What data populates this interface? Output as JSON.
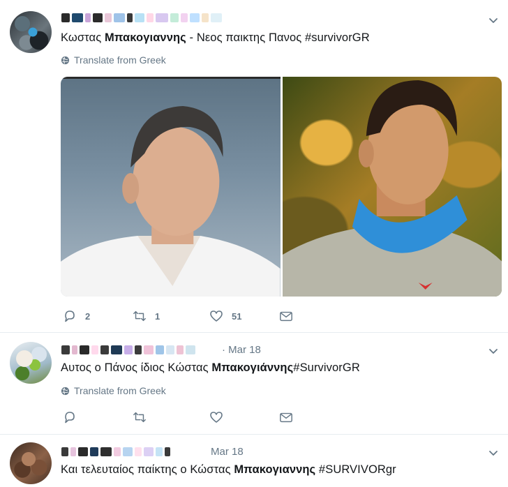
{
  "colors": {
    "text": "#14171a",
    "secondary": "#657786",
    "divider": "#e6ecf0",
    "accent": "#1b95e0"
  },
  "tweets": [
    {
      "date": "",
      "text_pre": "Κωστας ",
      "text_bold": "Μπακογιαννης",
      "text_post": " - Νεος παικτης Πανος  #survivorGR",
      "translate_label": "Translate from Greek",
      "has_media": true,
      "actions": {
        "reply_icon": "reply-icon",
        "reply_count": "2",
        "retweet_icon": "retweet-icon",
        "retweet_count": "1",
        "like_icon": "heart-icon",
        "like_count": "51",
        "dm_icon": "envelope-icon"
      }
    },
    {
      "date": "· Mar 18",
      "text_pre": "Αυτος ο Πάνος ίδιος Κώστας ",
      "text_bold": "Μπακογιάννης",
      "text_post": "#SurvivorGR",
      "translate_label": "Translate from Greek",
      "has_media": false,
      "actions": {
        "reply_icon": "reply-icon",
        "reply_count": "",
        "retweet_icon": "retweet-icon",
        "retweet_count": "",
        "like_icon": "heart-icon",
        "like_count": "",
        "dm_icon": "envelope-icon"
      }
    },
    {
      "date": "Mar 18",
      "text_pre": "Και τελευταίος παίκτης ο Κώστας ",
      "text_bold": "Μπακογιαννης",
      "text_post": "  #SURVIVORgr",
      "translate_label": "",
      "has_media": false
    }
  ]
}
